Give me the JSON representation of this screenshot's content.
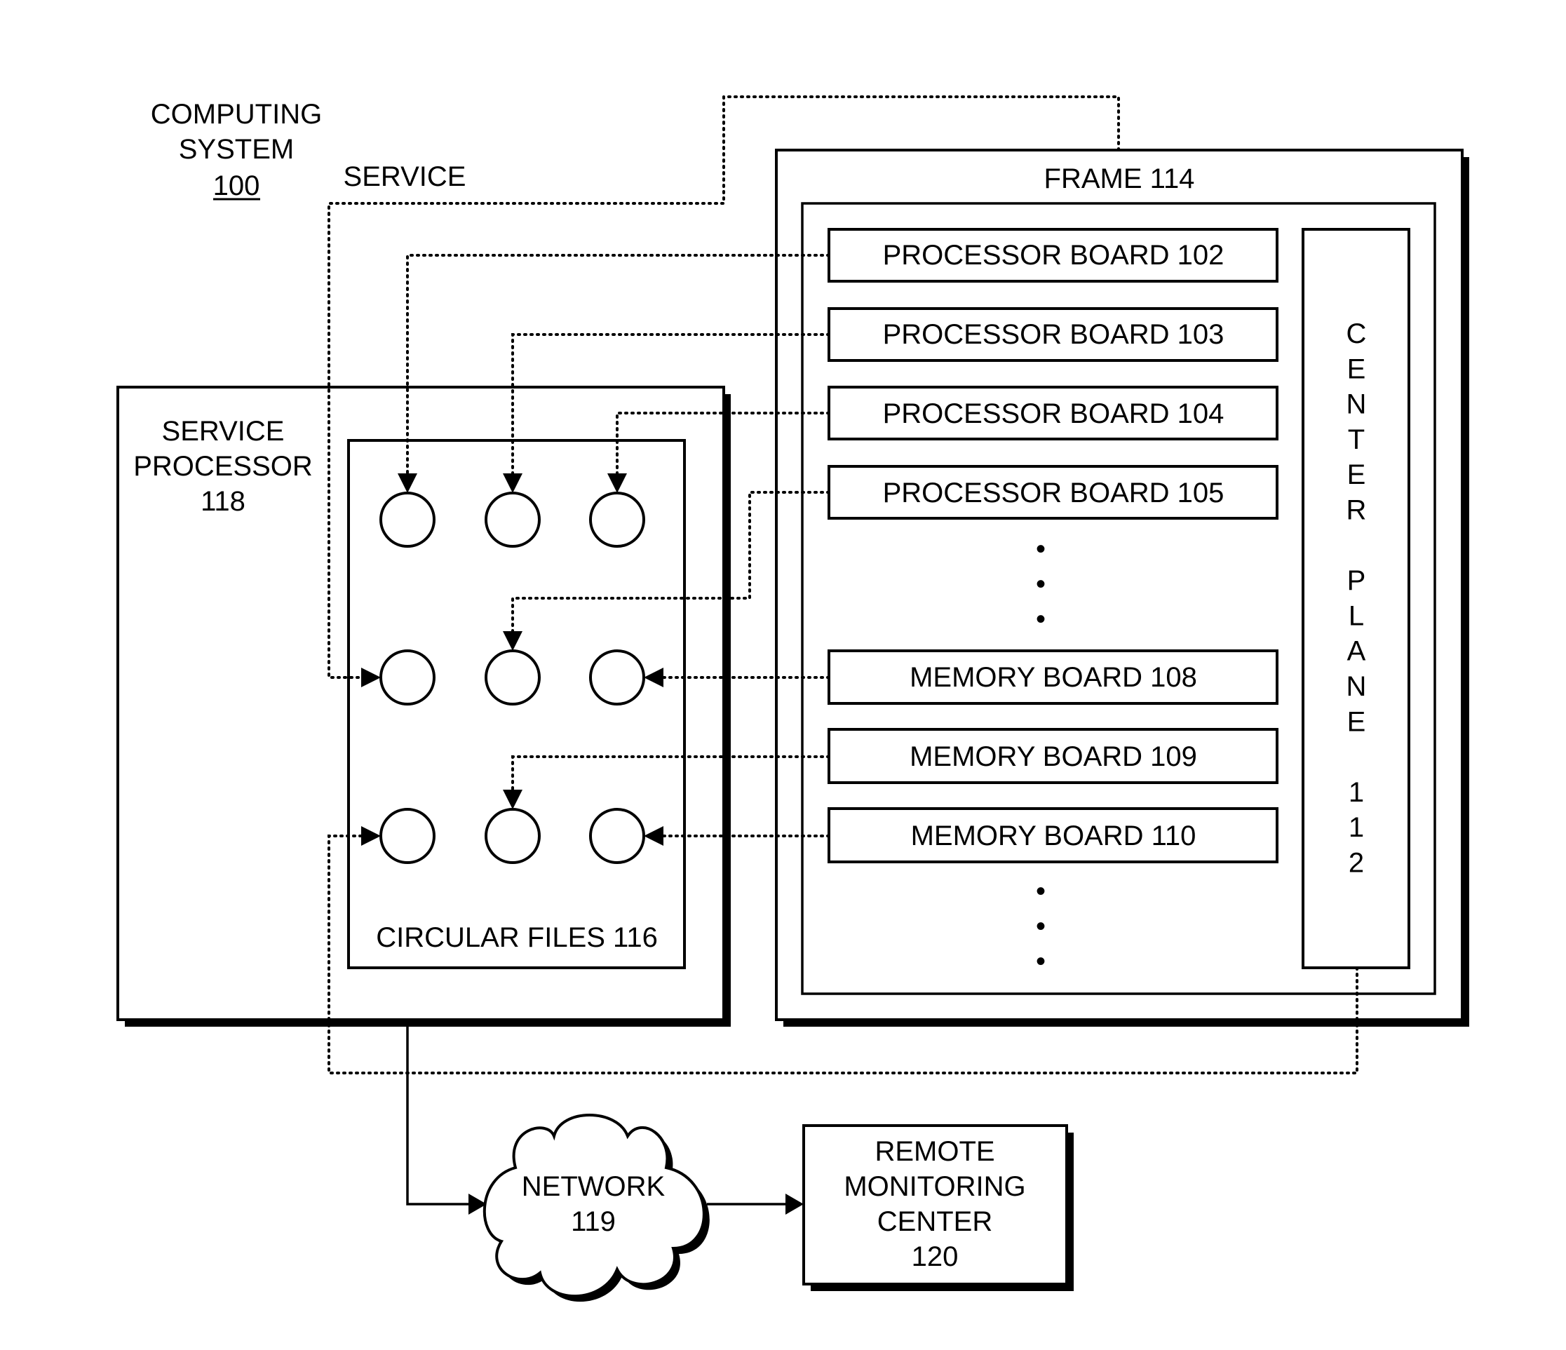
{
  "diagram": {
    "title": {
      "lines": [
        "COMPUTING",
        "SYSTEM"
      ],
      "ref": "100"
    },
    "service_label": "SERVICE",
    "frame": {
      "label": "FRAME  114",
      "boards": [
        {
          "label": "PROCESSOR BOARD  102"
        },
        {
          "label": "PROCESSOR BOARD  103"
        },
        {
          "label": "PROCESSOR BOARD  104"
        },
        {
          "label": "PROCESSOR BOARD  105"
        },
        {
          "label": "MEMORY BOARD  108"
        },
        {
          "label": "MEMORY BOARD  109"
        },
        {
          "label": "MEMORY BOARD  110"
        }
      ],
      "center_plane": {
        "letters": [
          "C",
          "E",
          "N",
          "T",
          "E",
          "R",
          "",
          "P",
          "L",
          "A",
          "N",
          "E",
          "",
          "1",
          "1",
          "2"
        ]
      },
      "ellipsis_symbol": "•"
    },
    "service_processor": {
      "lines": [
        "SERVICE",
        "PROCESSOR",
        "118"
      ],
      "circular_files_label": "CIRCULAR FILES  116"
    },
    "network": {
      "lines": [
        "NETWORK",
        "119"
      ]
    },
    "remote_monitoring_center": {
      "lines": [
        "REMOTE",
        "MONITORING",
        "CENTER",
        "120"
      ]
    }
  }
}
